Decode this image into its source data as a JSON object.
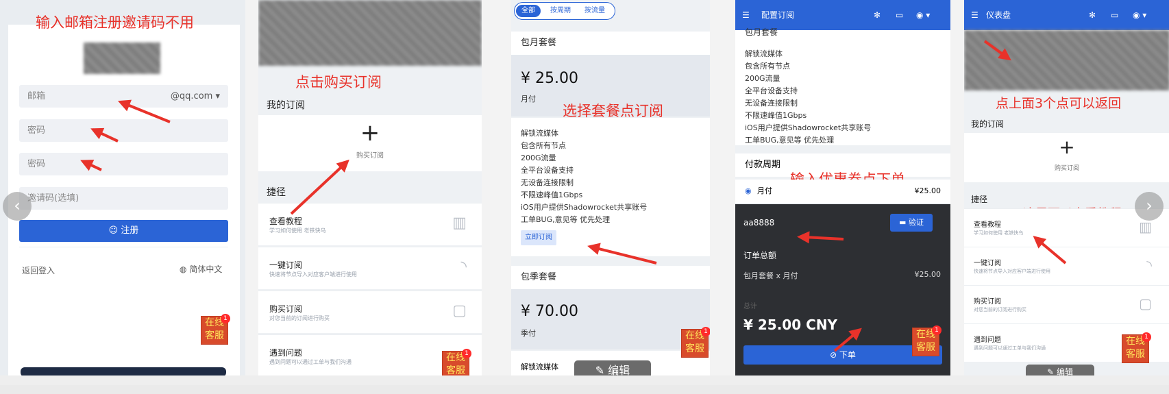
{
  "panel1": {
    "annotation": "输入邮箱注册邀请码不用",
    "email_placeholder": "邮箱",
    "email_suffix": "@qq.com",
    "password_placeholder": "密码",
    "confirm_placeholder": "密码",
    "invite_placeholder": "邀请码(选填)",
    "register_label": "☺ 注册",
    "back_login": "返回登入",
    "language": "简体中文"
  },
  "panel2": {
    "annotation": "点击购买订阅",
    "my_sub": "我的订阅",
    "buy_sub": "购买订阅",
    "shortcuts": "捷径",
    "items": [
      {
        "title": "查看教程",
        "sub": "学习如何使用 老铁快乌"
      },
      {
        "title": "一键订阅",
        "sub": "快速将节点导入对应客户端进行使用"
      },
      {
        "title": "购买订阅",
        "sub": "对您当前的订阅进行购买"
      },
      {
        "title": "遇到问题",
        "sub": "遇到问题可以通过工单与我们沟通"
      }
    ]
  },
  "panel3": {
    "tabs": [
      "全部",
      "按周期",
      "按流量"
    ],
    "plan1_name": "包月套餐",
    "plan1_price": "¥ 25.00",
    "plan1_period": "月付",
    "annotation": "选择套餐点订阅",
    "features": [
      "解锁流媒体",
      "包含所有节点",
      "200G流量",
      "全平台设备支持",
      "无设备连接限制",
      "不限速峰值1Gbps",
      "iOS用户提供Shadowrocket共享账号",
      "工单BUG,意见等 优先处理"
    ],
    "subscribe_label": "立即订阅",
    "plan2_name": "包季套餐",
    "plan2_price": "¥ 70.00",
    "plan2_period": "季付",
    "plan2_feature": "解锁流媒体",
    "edit_label": "编辑"
  },
  "panel4": {
    "title": "配置订阅",
    "header_cut": "包月套餐",
    "features": [
      "解锁流媒体",
      "包含所有节点",
      "200G流量",
      "全平台设备支持",
      "无设备连接限制",
      "不限速峰值1Gbps",
      "iOS用户提供Shadowrocket共享账号",
      "工单BUG,意见等 优先处理"
    ],
    "period_title": "付款周期",
    "annotation": "输入优惠卷点下单",
    "period_option": "月付",
    "period_price": "¥25.00",
    "coupon": "aa8888",
    "verify_label": "验证",
    "order_total": "订单总额",
    "order_line": "包月套餐 x 月付",
    "order_line_price": "¥25.00",
    "subtotal_label": "总计",
    "total": "¥ 25.00 CNY",
    "order_btn": "⊘ 下单"
  },
  "panel5": {
    "title": "仪表盘",
    "annotation_top": "点上面3个点可以返回",
    "my_sub": "我的订阅",
    "buy_sub": "购买订阅",
    "shortcuts": "捷径",
    "annotation_tutorial": "这里可以查看教程",
    "items": [
      {
        "title": "查看教程",
        "sub": "学习如何使用 老铁快乌"
      },
      {
        "title": "一键订阅",
        "sub": "快速将节点导入对应客户端进行使用"
      },
      {
        "title": "购买订阅",
        "sub": "对您当前的订阅进行购买"
      },
      {
        "title": "遇到问题",
        "sub": "遇到问题可以通过工单与我们沟通"
      }
    ],
    "edit_label": "编辑"
  },
  "kefu": {
    "line1": "在线",
    "line2": "客服",
    "badge": "1"
  },
  "colors": {
    "accent": "#2b64d6",
    "annotation": "#e8322a",
    "dark_panel": "#2d2f33"
  }
}
